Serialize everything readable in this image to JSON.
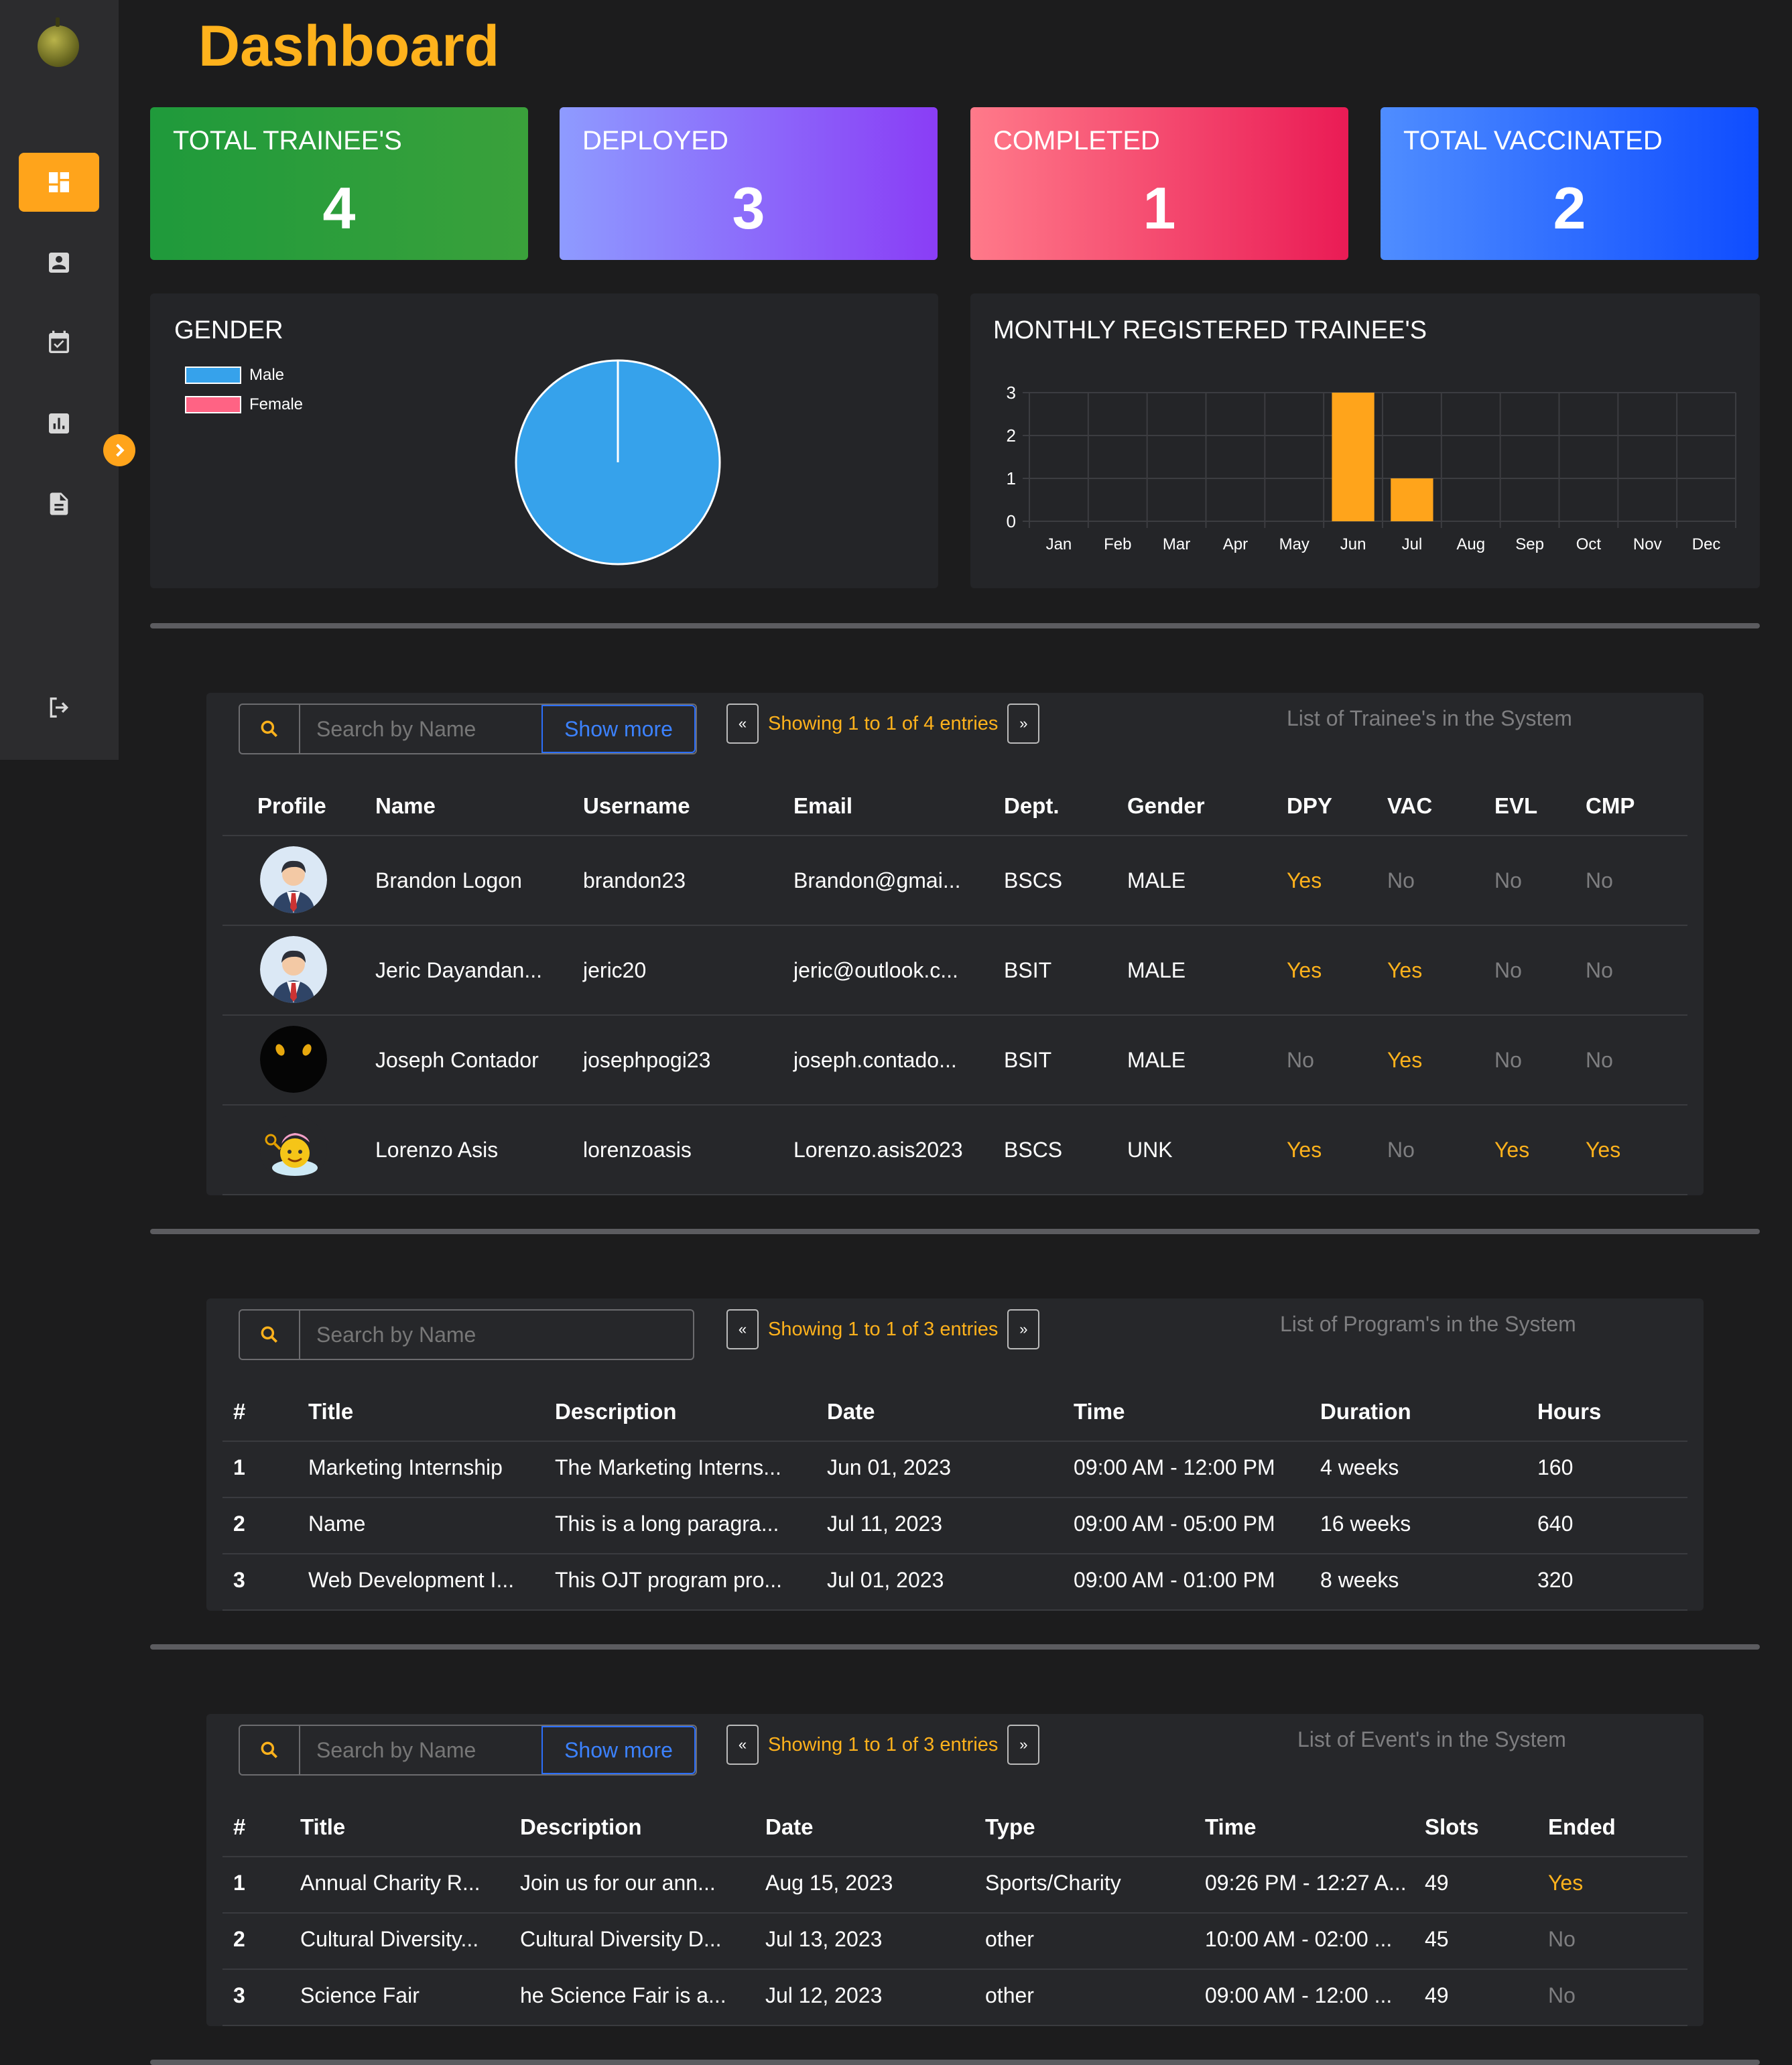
{
  "page": {
    "title": "Dashboard"
  },
  "colors": {
    "accent": "#ffa41b",
    "yes": "#ffb21c",
    "no": "#7e7e80",
    "link": "#3c82ff",
    "male": "#36a2eb",
    "female": "#ff6384",
    "bar": "#ffa41b"
  },
  "sidebar": {
    "items": [
      {
        "icon": "dashboard-icon",
        "active": true
      },
      {
        "icon": "account-box-icon",
        "active": false
      },
      {
        "icon": "event-check-icon",
        "active": false
      },
      {
        "icon": "report-icon",
        "active": false
      },
      {
        "icon": "document-icon",
        "active": false
      }
    ],
    "logout_icon": "logout-icon",
    "toggle_icon": "chevron-right-icon"
  },
  "stats": {
    "total_trainees": {
      "label": "TOTAL TRAINEE'S",
      "value": "4"
    },
    "deployed": {
      "label": "DEPLOYED",
      "value": "3"
    },
    "completed": {
      "label": "COMPLETED",
      "value": "1"
    },
    "total_vaccinated": {
      "label": "TOTAL VACCINATED",
      "value": "2"
    }
  },
  "gender_chart": {
    "title": "GENDER",
    "legend": [
      "Male",
      "Female"
    ]
  },
  "monthly_chart": {
    "title": "MONTHLY REGISTERED TRAINEE'S"
  },
  "chart_data": [
    {
      "type": "pie",
      "title": "GENDER",
      "categories": [
        "Male",
        "Female"
      ],
      "values": [
        4,
        0
      ],
      "legend": "top-left"
    },
    {
      "type": "bar",
      "title": "MONTHLY REGISTERED TRAINEE'S",
      "categories": [
        "Jan",
        "Feb",
        "Mar",
        "Apr",
        "May",
        "Jun",
        "Jul",
        "Aug",
        "Sep",
        "Oct",
        "Nov",
        "Dec"
      ],
      "values": [
        0,
        0,
        0,
        0,
        0,
        3,
        1,
        0,
        0,
        0,
        0,
        0
      ],
      "ylim": [
        0,
        3
      ],
      "yticks": [
        "0",
        "1",
        "2",
        "3"
      ],
      "grid": true
    }
  ],
  "trainees": {
    "search_placeholder": "Search by Name",
    "show_more": "Show more",
    "pager_prev": "«",
    "pager_next": "»",
    "showing": "Showing 1 to 1 of 4 entries",
    "caption": "List of Trainee's in the System",
    "columns": [
      "Profile",
      "Name",
      "Username",
      "Email",
      "Dept.",
      "Gender",
      "DPY",
      "VAC",
      "EVL",
      "CMP"
    ],
    "rows": [
      {
        "name": "Brandon Logon",
        "username": "brandon23",
        "email": "Brandon@gmai...",
        "dept": "BSCS",
        "gender": "MALE",
        "dpy": "Yes",
        "vac": "No",
        "evl": "No",
        "cmp": "No",
        "avatar": "businessman-avatar-icon"
      },
      {
        "name": "Jeric Dayandan...",
        "username": "jeric20",
        "email": "jeric@outlook.c...",
        "dept": "BSIT",
        "gender": "MALE",
        "dpy": "Yes",
        "vac": "Yes",
        "evl": "No",
        "cmp": "No",
        "avatar": "businessman-avatar-icon"
      },
      {
        "name": "Joseph Contador",
        "username": "josephpogi23",
        "email": "joseph.contado...",
        "dept": "BSIT",
        "gender": "MALE",
        "dpy": "No",
        "vac": "Yes",
        "evl": "No",
        "cmp": "No",
        "avatar": "dark-eyes-avatar-icon"
      },
      {
        "name": "Lorenzo Asis",
        "username": "lorenzoasis",
        "email": "Lorenzo.asis2023",
        "dept": "BSCS",
        "gender": "UNK",
        "dpy": "Yes",
        "vac": "No",
        "evl": "Yes",
        "cmp": "Yes",
        "avatar": "cartoon-avatar-icon"
      }
    ]
  },
  "programs": {
    "search_placeholder": "Search by Name",
    "pager_prev": "«",
    "pager_next": "»",
    "showing": "Showing 1 to 1 of 3 entries",
    "caption": "List of Program's in the System",
    "columns": [
      "#",
      "Title",
      "Description",
      "Date",
      "Time",
      "Duration",
      "Hours"
    ],
    "rows": [
      {
        "num": "1",
        "title": "Marketing Internship",
        "description": "The Marketing Interns...",
        "date": "Jun 01, 2023",
        "time": "09:00 AM - 12:00 PM",
        "duration": "4 weeks",
        "hours": "160"
      },
      {
        "num": "2",
        "title": "Name",
        "description": "This is a long paragra...",
        "date": "Jul 11, 2023",
        "time": "09:00 AM - 05:00 PM",
        "duration": "16 weeks",
        "hours": "640"
      },
      {
        "num": "3",
        "title": "Web Development I...",
        "description": "This OJT program pro...",
        "date": "Jul 01, 2023",
        "time": "09:00 AM - 01:00 PM",
        "duration": "8 weeks",
        "hours": "320"
      }
    ]
  },
  "events": {
    "search_placeholder": "Search by Name",
    "show_more": "Show more",
    "pager_prev": "«",
    "pager_next": "»",
    "showing": "Showing 1 to 1 of 3 entries",
    "caption": "List of Event's in the System",
    "columns": [
      "#",
      "Title",
      "Description",
      "Date",
      "Type",
      "Time",
      "Slots",
      "Ended"
    ],
    "rows": [
      {
        "num": "1",
        "title": "Annual Charity R...",
        "description": "Join us for our ann...",
        "date": "Aug 15, 2023",
        "type": "Sports/Charity",
        "time": "09:26 PM - 12:27 A...",
        "slots": "49",
        "ended": "Yes"
      },
      {
        "num": "2",
        "title": "Cultural Diversity...",
        "description": "Cultural Diversity D...",
        "date": "Jul 13, 2023",
        "type": "other",
        "time": "10:00 AM - 02:00 ...",
        "slots": "45",
        "ended": "No"
      },
      {
        "num": "3",
        "title": "Science Fair",
        "description": "he Science Fair is a...",
        "date": "Jul 12, 2023",
        "type": "other",
        "time": "09:00 AM - 12:00 ...",
        "slots": "49",
        "ended": "No"
      }
    ]
  }
}
